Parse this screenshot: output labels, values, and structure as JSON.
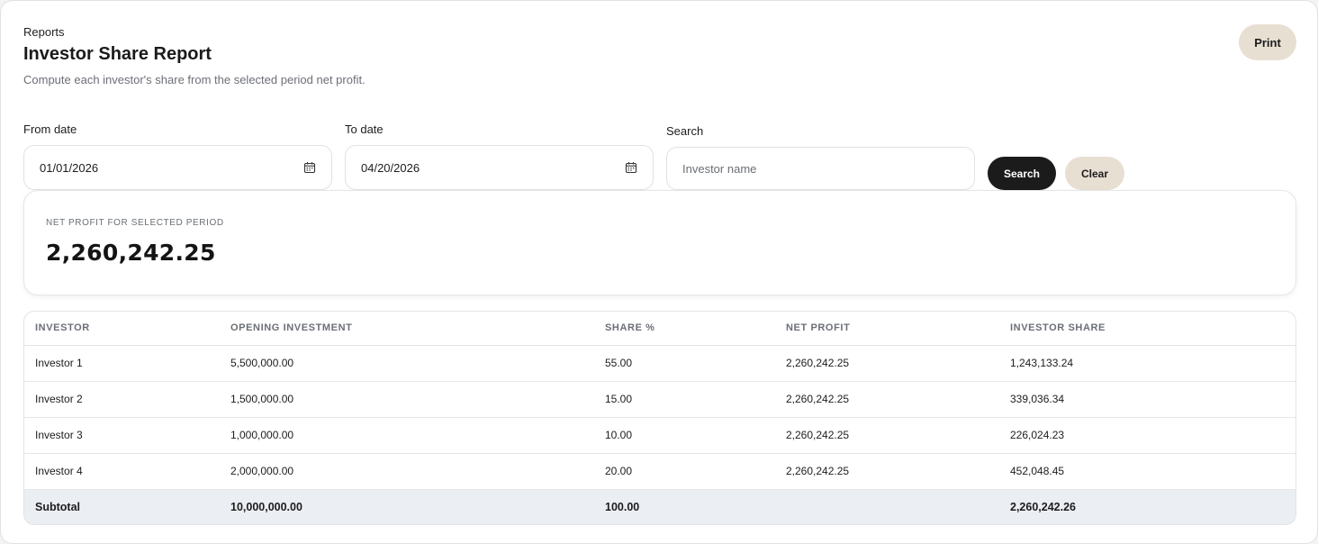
{
  "header": {
    "breadcrumb": "Reports",
    "title": "Investor Share Report",
    "subtitle": "Compute each investor's share from the selected period net profit.",
    "print_label": "Print"
  },
  "filters": {
    "from_label": "From date",
    "from_value": "01/01/2026",
    "to_label": "To date",
    "to_value": "04/20/2026",
    "search_label": "Search",
    "search_placeholder": "Investor name",
    "search_button": "Search",
    "clear_button": "Clear"
  },
  "summary": {
    "label": "NET PROFIT FOR SELECTED PERIOD",
    "value": "2,260,242.25"
  },
  "table": {
    "columns": [
      "INVESTOR",
      "OPENING INVESTMENT",
      "SHARE %",
      "NET PROFIT",
      "INVESTOR SHARE"
    ],
    "rows": [
      [
        "Investor 1",
        "5,500,000.00",
        "55.00",
        "2,260,242.25",
        "1,243,133.24"
      ],
      [
        "Investor 2",
        "1,500,000.00",
        "15.00",
        "2,260,242.25",
        "339,036.34"
      ],
      [
        "Investor 3",
        "1,000,000.00",
        "10.00",
        "2,260,242.25",
        "226,024.23"
      ],
      [
        "Investor 4",
        "2,000,000.00",
        "20.00",
        "2,260,242.25",
        "452,048.45"
      ]
    ],
    "subtotal": [
      "Subtotal",
      "10,000,000.00",
      "100.00",
      "",
      "2,260,242.26"
    ]
  },
  "icons": {
    "date_picker": "calendar-icon"
  },
  "colors": {
    "primary_button": "#1b1b1b",
    "secondary_button": "#e8dfd3",
    "subtotal_row": "#ebeef3"
  }
}
